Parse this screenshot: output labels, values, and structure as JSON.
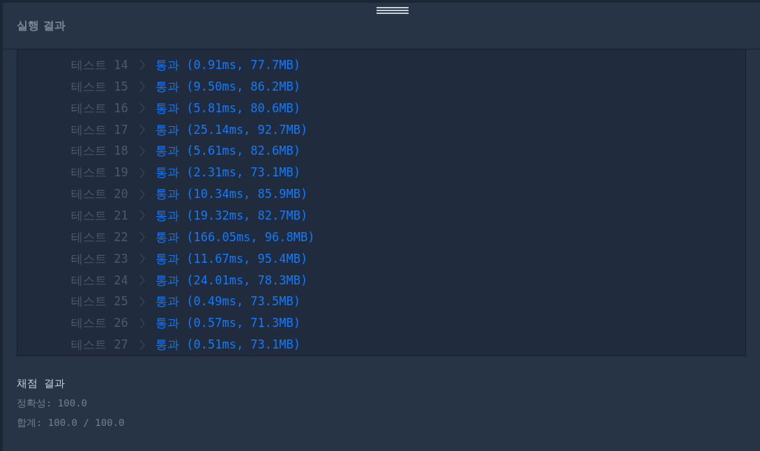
{
  "panel": {
    "title": "실행 결과"
  },
  "tests": [
    {
      "label": "테스트 14",
      "result": "통과 (0.91ms, 77.7MB)"
    },
    {
      "label": "테스트 15",
      "result": "통과 (9.50ms, 86.2MB)"
    },
    {
      "label": "테스트 16",
      "result": "통과 (5.81ms, 80.6MB)"
    },
    {
      "label": "테스트 17",
      "result": "통과 (25.14ms, 92.7MB)"
    },
    {
      "label": "테스트 18",
      "result": "통과 (5.61ms, 82.6MB)"
    },
    {
      "label": "테스트 19",
      "result": "통과 (2.31ms, 73.1MB)"
    },
    {
      "label": "테스트 20",
      "result": "통과 (10.34ms, 85.9MB)"
    },
    {
      "label": "테스트 21",
      "result": "통과 (19.32ms, 82.7MB)"
    },
    {
      "label": "테스트 22",
      "result": "통과 (166.05ms, 96.8MB)"
    },
    {
      "label": "테스트 23",
      "result": "통과 (11.67ms, 95.4MB)"
    },
    {
      "label": "테스트 24",
      "result": "통과 (24.01ms, 78.3MB)"
    },
    {
      "label": "테스트 25",
      "result": "통과 (0.49ms, 73.5MB)"
    },
    {
      "label": "테스트 26",
      "result": "통과 (0.57ms, 71.3MB)"
    },
    {
      "label": "테스트 27",
      "result": "통과 (0.51ms, 73.1MB)"
    }
  ],
  "grading": {
    "title": "채점 결과",
    "lines": [
      "정확성: 100.0",
      "합계: 100.0 / 100.0"
    ]
  }
}
